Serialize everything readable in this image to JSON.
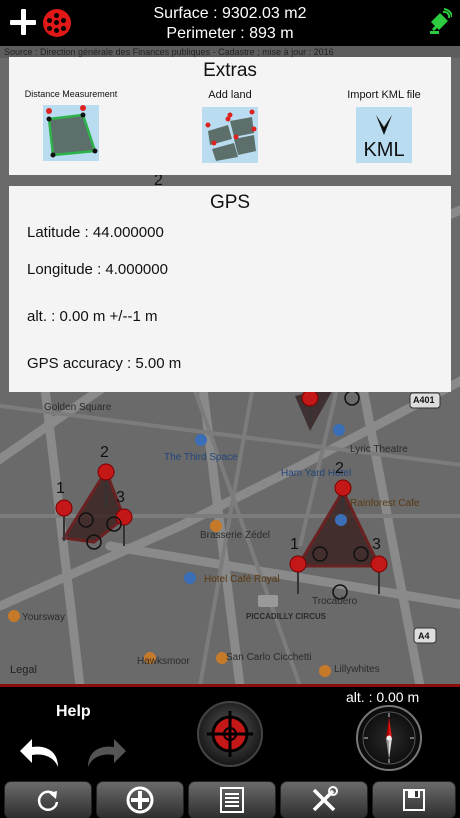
{
  "top": {
    "surface": "Surface : 9302.03 m2",
    "perimeter": "Perimeter : 893 m",
    "source": "Source : Direction générale des Finances publiques - Cadastre ; mise à jour : 2016"
  },
  "extras": {
    "title": "Extras",
    "tools": [
      {
        "label": "Distance Measurement",
        "icon": "distance-measurement-icon"
      },
      {
        "label": "Add land",
        "icon": "add-land-icon"
      },
      {
        "label": "Import KML file",
        "icon": "kml-import-icon",
        "icon_text": "KML"
      }
    ]
  },
  "gps": {
    "title": "GPS",
    "latitude": "Latitude : 44.000000",
    "longitude": "Longitude : 4.000000",
    "altitude": "alt. : 0.00 m +/--1 m",
    "accuracy": "GPS accuracy : 5.00 m"
  },
  "map": {
    "labels": {
      "golden_square": "Golden Square",
      "third_space": "The Third Space",
      "lyric": "Lyric Theatre",
      "ham_yard": "Ham Yard Hotel",
      "rainforest": "Rainforest Cafe",
      "zedel": "Brasserie Zédel",
      "hotel_cafe": "Hotel Café Royal",
      "piccadilly": "PICCADILLY CIRCUS",
      "hawksmoor": "Hawksmoor",
      "san_carlo": "San Carlo Cicchetti",
      "lillywhites": "Lillywhites",
      "yoursway": "Yoursway",
      "trocadero": "Trocadero",
      "a401": "A401",
      "a4": "A4",
      "legal": "Legal"
    },
    "plot_left_numbers": [
      "1",
      "2",
      "3"
    ],
    "plot_right_numbers": [
      "1",
      "2",
      "3"
    ],
    "top_number": "2"
  },
  "bottom": {
    "help": "Help",
    "altitude": "alt. : 0.00 m",
    "tabs": [
      {
        "name": "refresh",
        "icon": "refresh-icon"
      },
      {
        "name": "locate",
        "icon": "locate-icon"
      },
      {
        "name": "list",
        "icon": "list-icon"
      },
      {
        "name": "tools",
        "icon": "tools-icon"
      },
      {
        "name": "save",
        "icon": "save-icon"
      }
    ]
  },
  "colors": {
    "accent_red": "#e01818",
    "border_red": "#8b0d0d",
    "panel_bg": "#f4f4f4",
    "icon_bg": "#b9dcf0"
  }
}
